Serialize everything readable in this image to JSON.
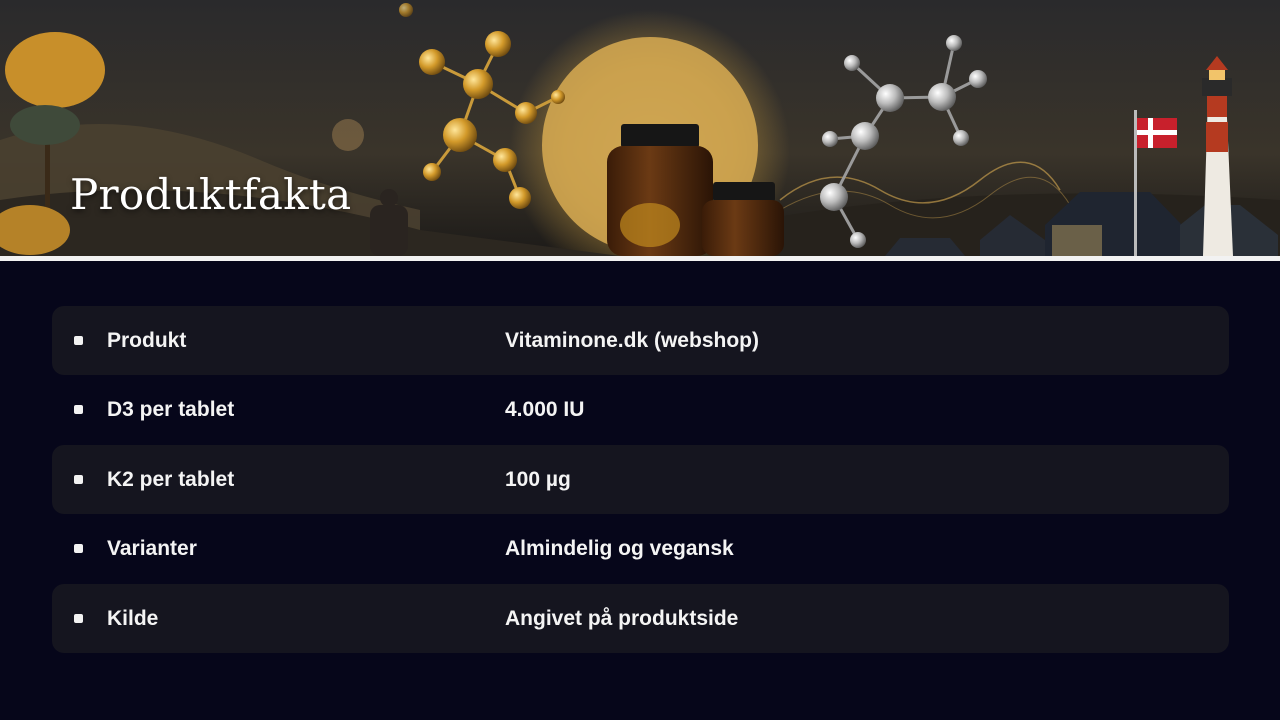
{
  "title": "Produktfakta",
  "rows": [
    {
      "label": "Produkt",
      "value": "Vitaminone.dk (webshop)"
    },
    {
      "label": "D3 per tablet",
      "value": "4.000 IU"
    },
    {
      "label": "K2 per tablet",
      "value": "100 µg"
    },
    {
      "label": "Varianter",
      "value": "Almindelig og vegansk"
    },
    {
      "label": "Kilde",
      "value": "Angivet på produktside"
    }
  ],
  "colors": {
    "background": "#06061a",
    "row_shade": "#15151f",
    "text": "#f4f4f4",
    "divider": "#f2f2f2"
  }
}
